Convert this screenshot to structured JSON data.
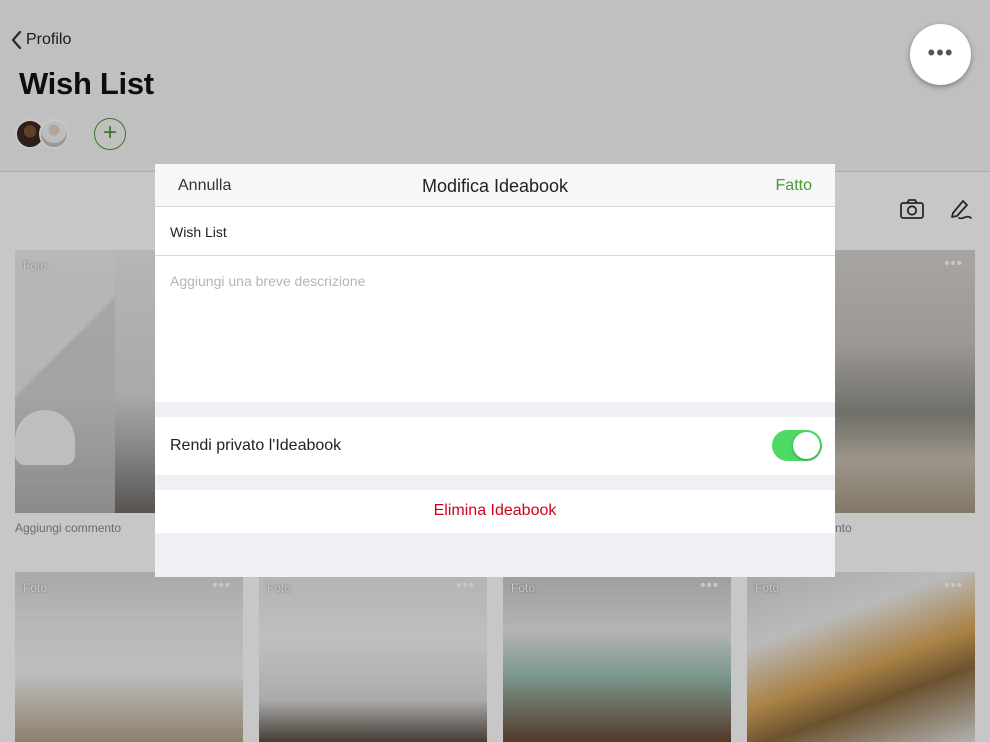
{
  "status_bar": {
    "device": "iPad"
  },
  "header": {
    "back_label": "Profilo",
    "title": "Wish List",
    "add_collaborator_symbol": "+"
  },
  "more_button_symbol": "•••",
  "photos": [
    {
      "tag": "Foto",
      "menu": "•••",
      "caption": "Aggiungi commento"
    },
    {
      "tag": "",
      "menu": "•••",
      "caption": "nto"
    },
    {
      "tag": "Foto",
      "menu": "•••"
    },
    {
      "tag": "Foto",
      "menu": "•••"
    },
    {
      "tag": "Foto",
      "menu": "•••"
    },
    {
      "tag": "Foto",
      "menu": "•••"
    }
  ],
  "modal": {
    "cancel_label": "Annulla",
    "title": "Modifica Ideabook",
    "done_label": "Fatto",
    "name_value": "Wish List",
    "description_placeholder": "Aggiungi una breve descrizione",
    "private_label": "Rendi privato l'Ideabook",
    "private_enabled": true,
    "delete_label": "Elimina Ideabook"
  },
  "colors": {
    "accent_green": "#4a9a2f",
    "toggle_on": "#4cd964",
    "destructive": "#d0021b"
  },
  "icons": [
    "chevron-left-icon",
    "wifi-icon",
    "battery-icon",
    "plus-icon",
    "more-dots-icon",
    "camera-icon",
    "edit-pen-icon"
  ]
}
